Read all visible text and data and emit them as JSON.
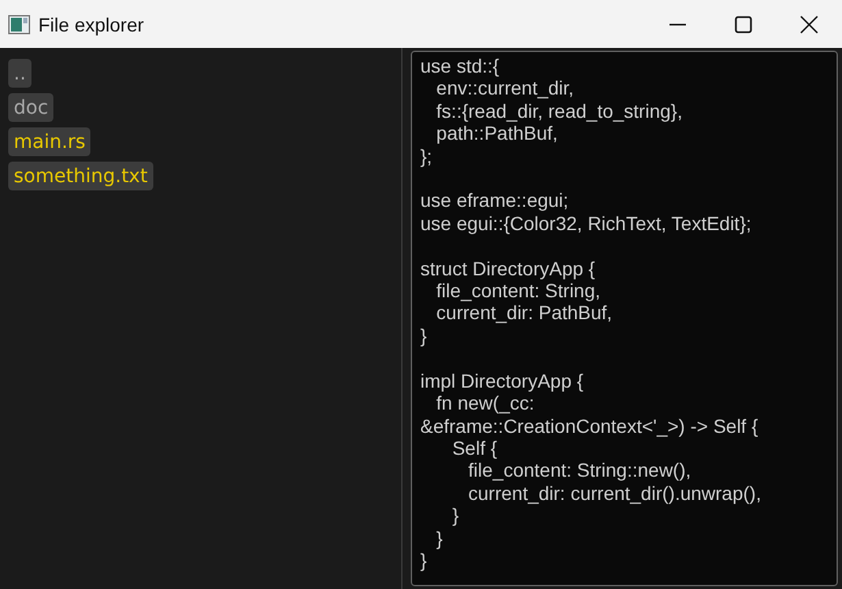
{
  "window": {
    "title": "File explorer"
  },
  "entries": [
    {
      "name": "..",
      "kind": "dir"
    },
    {
      "name": "doc",
      "kind": "dir"
    },
    {
      "name": "main.rs",
      "kind": "file"
    },
    {
      "name": "something.txt",
      "kind": "file"
    }
  ],
  "editor": {
    "value": "use std::{\n   env::current_dir,\n   fs::{read_dir, read_to_string},\n   path::PathBuf,\n};\n\nuse eframe::egui;\nuse egui::{Color32, RichText, TextEdit};\n\nstruct DirectoryApp {\n   file_content: String,\n   current_dir: PathBuf,\n}\n\nimpl DirectoryApp {\n   fn new(_cc:\n&eframe::CreationContext<'_>) -> Self {\n      Self {\n         file_content: String::new(),\n         current_dir: current_dir().unwrap(),\n      }\n   }\n}"
  }
}
